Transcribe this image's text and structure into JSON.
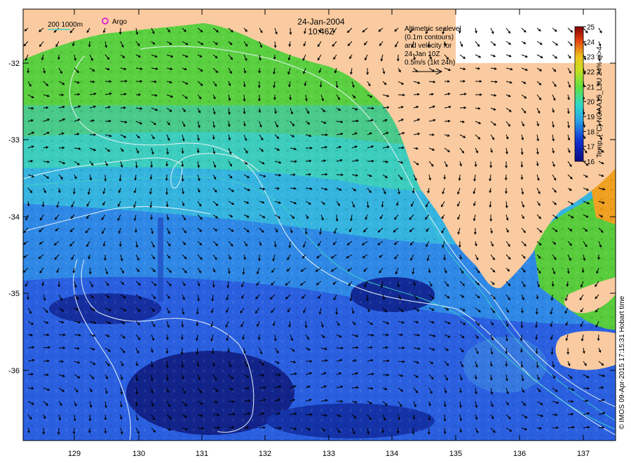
{
  "title": {
    "date": "24-Jan-2004",
    "time": "10:46Z"
  },
  "legend": {
    "bathymetry": "200  1000m",
    "argo": "Argo"
  },
  "note": {
    "line1": "Altimetric sealevel",
    "line2": "(0.1m contours)",
    "line3": "and velocity for",
    "line4": "24-Jan 10Z",
    "line5": "0.5m/s (1kt 24h)"
  },
  "colorbar": {
    "label": "Temp. (°C) NOAA15_L3U 24% qi>4",
    "ticks": [
      "25",
      "24",
      "23",
      "22",
      "21",
      "20",
      "19",
      "18",
      "17",
      "16"
    ],
    "range": [
      16,
      25
    ]
  },
  "credit": "© IMOS 09-Apr-2015 17:15:31 Hobart time",
  "axes": {
    "x_ticks": [
      "129",
      "130",
      "131",
      "132",
      "133",
      "134",
      "135",
      "136",
      "137"
    ],
    "y_ticks": [
      "-32",
      "-33",
      "-34",
      "-35",
      "-36"
    ]
  },
  "colors": {
    "land": "#facba0",
    "contour": "#e6f2f5",
    "bathy": "#40d4c4",
    "argo": "#e000e0",
    "arrow": "#000000"
  }
}
